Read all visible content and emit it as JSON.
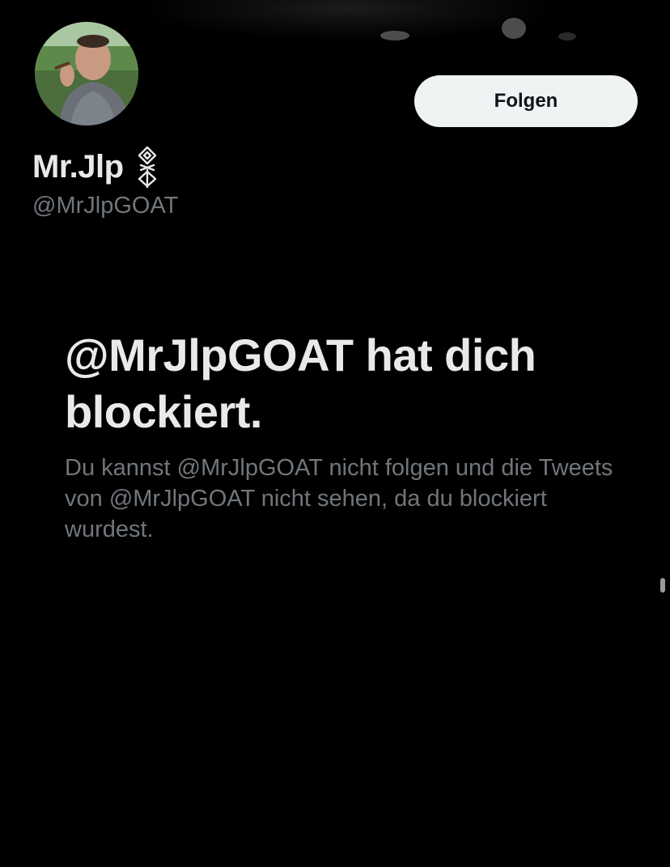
{
  "profile": {
    "display_name": "Mr.Jlp",
    "handle": "@MrJlpGOAT",
    "follow_label": "Folgen"
  },
  "blocked": {
    "title": "@MrJlpGOAT hat dich blockiert.",
    "description": "Du kannst @MrJlpGOAT nicht folgen und die Tweets von @MrJlpGOAT nicht sehen, da du blockiert wurdest."
  },
  "icons": {
    "name_symbol": "rune-symbol-icon",
    "avatar": "profile-photo"
  },
  "colors": {
    "background": "#000000",
    "primary_text": "#e7e9ea",
    "secondary_text": "#71767b",
    "follow_button_bg": "#eff3f4",
    "follow_button_text": "#0f1419"
  }
}
